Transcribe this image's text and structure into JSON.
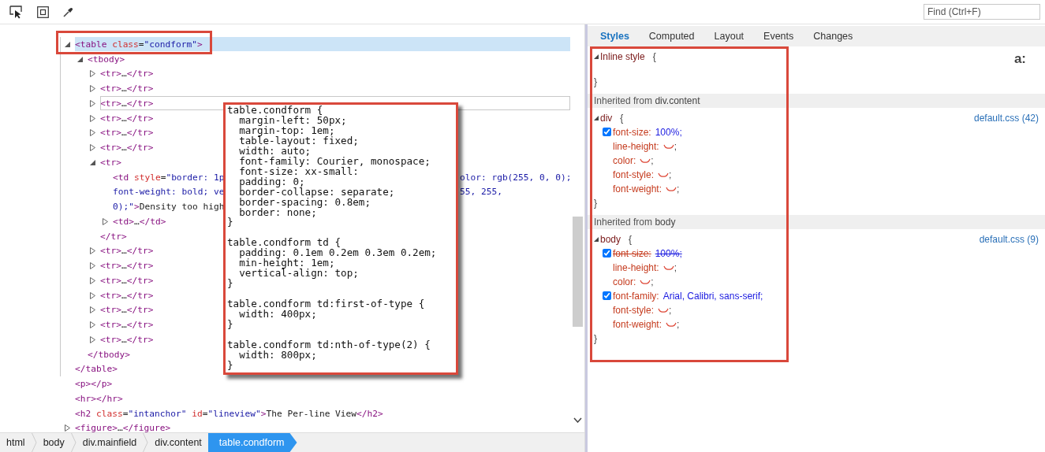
{
  "toolbar": {
    "find": {
      "placeholder": "Find (Ctrl+F)"
    }
  },
  "dom_tree": {
    "nodes": [
      {
        "expanded": true,
        "selected": true,
        "hovered": false,
        "tokens": [
          {
            "kind": "tag",
            "text": "<table"
          },
          {
            "kind": "attr",
            "text": " class"
          },
          {
            "kind": "punct",
            "text": "="
          },
          {
            "kind": "value",
            "text": "\"condform\""
          },
          {
            "kind": "tag",
            "text": ">"
          }
        ],
        "close_tokens": [
          {
            "kind": "tag",
            "text": "</table>"
          }
        ],
        "children": [
          {
            "expanded": true,
            "selected": false,
            "hovered": false,
            "tokens": [
              {
                "kind": "tag",
                "text": "<tbody>"
              }
            ],
            "close_tokens": [
              {
                "kind": "tag",
                "text": "</tbody>"
              }
            ],
            "children": [
              {
                "expanded": false,
                "selected": false,
                "hovered": false,
                "tokens": [
                  {
                    "kind": "tag",
                    "text": "<tr>"
                  },
                  {
                    "kind": "text",
                    "text": "…"
                  },
                  {
                    "kind": "tag",
                    "text": "</tr>"
                  }
                ]
              },
              {
                "expanded": false,
                "selected": false,
                "hovered": false,
                "tokens": [
                  {
                    "kind": "tag",
                    "text": "<tr>"
                  },
                  {
                    "kind": "text",
                    "text": "…"
                  },
                  {
                    "kind": "tag",
                    "text": "</tr>"
                  }
                ]
              },
              {
                "expanded": false,
                "selected": false,
                "hovered": true,
                "tokens": [
                  {
                    "kind": "tag",
                    "text": "<tr>"
                  },
                  {
                    "kind": "text",
                    "text": "…"
                  },
                  {
                    "kind": "tag",
                    "text": "</tr>"
                  }
                ]
              },
              {
                "expanded": false,
                "selected": false,
                "hovered": false,
                "tokens": [
                  {
                    "kind": "tag",
                    "text": "<tr>"
                  },
                  {
                    "kind": "text",
                    "text": "…"
                  },
                  {
                    "kind": "tag",
                    "text": "</tr>"
                  }
                ]
              },
              {
                "expanded": false,
                "selected": false,
                "hovered": false,
                "tokens": [
                  {
                    "kind": "tag",
                    "text": "<tr>"
                  },
                  {
                    "kind": "text",
                    "text": "…"
                  },
                  {
                    "kind": "tag",
                    "text": "</tr>"
                  }
                ]
              },
              {
                "expanded": false,
                "selected": false,
                "hovered": false,
                "tokens": [
                  {
                    "kind": "tag",
                    "text": "<tr>"
                  },
                  {
                    "kind": "text",
                    "text": "…"
                  },
                  {
                    "kind": "tag",
                    "text": "</tr>"
                  }
                ]
              },
              {
                "expanded": true,
                "selected": false,
                "hovered": false,
                "tokens": [
                  {
                    "kind": "tag",
                    "text": "<tr>"
                  }
                ],
                "close_tokens": [
                  {
                    "kind": "tag",
                    "text": "</tr>"
                  }
                ],
                "children": [
                  {
                    "lines": [
                      {
                        "left": [
                          {
                            "kind": "tag",
                            "text": "<td"
                          },
                          {
                            "kind": "attr",
                            "text": " style"
                          },
                          {
                            "kind": "punct",
                            "text": "="
                          },
                          {
                            "kind": "value",
                            "text": "\"border: 1p"
                          }
                        ],
                        "right": [
                          {
                            "kind": "value",
                            "text": "olor: rgb(255, 0, 0);"
                          }
                        ]
                      },
                      {
                        "left": [
                          {
                            "kind": "value",
                            "text": "font-weight: bold; ve"
                          }
                        ],
                        "right": [
                          {
                            "kind": "value",
                            "text": "55, 255,"
                          }
                        ]
                      },
                      {
                        "left": [
                          {
                            "kind": "value",
                            "text": "0);\""
                          },
                          {
                            "kind": "tag",
                            "text": ">"
                          },
                          {
                            "kind": "text",
                            "text": "Density too high"
                          }
                        ]
                      }
                    ]
                  },
                  {
                    "expanded": false,
                    "selected": false,
                    "hovered": false,
                    "tokens": [
                      {
                        "kind": "tag",
                        "text": "<td>"
                      },
                      {
                        "kind": "text",
                        "text": "…"
                      },
                      {
                        "kind": "tag",
                        "text": "</td>"
                      }
                    ]
                  }
                ]
              },
              {
                "expanded": false,
                "selected": false,
                "hovered": false,
                "tokens": [
                  {
                    "kind": "tag",
                    "text": "<tr>"
                  },
                  {
                    "kind": "text",
                    "text": "…"
                  },
                  {
                    "kind": "tag",
                    "text": "</tr>"
                  }
                ]
              },
              {
                "expanded": false,
                "selected": false,
                "hovered": false,
                "tokens": [
                  {
                    "kind": "tag",
                    "text": "<tr>"
                  },
                  {
                    "kind": "text",
                    "text": "…"
                  },
                  {
                    "kind": "tag",
                    "text": "</tr>"
                  }
                ]
              },
              {
                "expanded": false,
                "selected": false,
                "hovered": false,
                "tokens": [
                  {
                    "kind": "tag",
                    "text": "<tr>"
                  },
                  {
                    "kind": "text",
                    "text": "…"
                  },
                  {
                    "kind": "tag",
                    "text": "</tr>"
                  }
                ]
              },
              {
                "expanded": false,
                "selected": false,
                "hovered": false,
                "tokens": [
                  {
                    "kind": "tag",
                    "text": "<tr>"
                  },
                  {
                    "kind": "text",
                    "text": "…"
                  },
                  {
                    "kind": "tag",
                    "text": "</tr>"
                  }
                ]
              },
              {
                "expanded": false,
                "selected": false,
                "hovered": false,
                "tokens": [
                  {
                    "kind": "tag",
                    "text": "<tr>"
                  },
                  {
                    "kind": "text",
                    "text": "…"
                  },
                  {
                    "kind": "tag",
                    "text": "</tr>"
                  }
                ]
              },
              {
                "expanded": false,
                "selected": false,
                "hovered": false,
                "tokens": [
                  {
                    "kind": "tag",
                    "text": "<tr>"
                  },
                  {
                    "kind": "text",
                    "text": "…"
                  },
                  {
                    "kind": "tag",
                    "text": "</tr>"
                  }
                ]
              },
              {
                "expanded": false,
                "selected": false,
                "hovered": false,
                "tokens": [
                  {
                    "kind": "tag",
                    "text": "<tr>"
                  },
                  {
                    "kind": "text",
                    "text": "…"
                  },
                  {
                    "kind": "tag",
                    "text": "</tr>"
                  }
                ]
              }
            ]
          }
        ]
      },
      {
        "selected": false,
        "hovered": false,
        "tokens": [
          {
            "kind": "tag",
            "text": "<p></p>"
          }
        ]
      },
      {
        "selected": false,
        "hovered": false,
        "tokens": [
          {
            "kind": "tag",
            "text": "<hr></hr>"
          }
        ]
      },
      {
        "selected": false,
        "hovered": false,
        "tokens": [
          {
            "kind": "tag",
            "text": "<h2"
          },
          {
            "kind": "attr",
            "text": " class"
          },
          {
            "kind": "punct",
            "text": "="
          },
          {
            "kind": "value",
            "text": "\"intanchor\""
          },
          {
            "kind": "attr",
            "text": " id"
          },
          {
            "kind": "punct",
            "text": "="
          },
          {
            "kind": "value",
            "text": "\"lineview\""
          },
          {
            "kind": "tag",
            "text": ">"
          },
          {
            "kind": "text",
            "text": "The Per-line View"
          },
          {
            "kind": "tag",
            "text": "</h2>"
          }
        ]
      },
      {
        "expanded": false,
        "selected": false,
        "hovered": false,
        "tokens": [
          {
            "kind": "tag",
            "text": "<figure>"
          },
          {
            "kind": "text",
            "text": "…"
          },
          {
            "kind": "tag",
            "text": "</figure>"
          }
        ]
      }
    ]
  },
  "callout": {
    "code": "table.condform {\n  margin-left: 50px;\n  margin-top: 1em;\n  table-layout: fixed;\n  width: auto;\n  font-family: Courier, monospace;\n  font-size: xx-small:\n  padding: 0;\n  border-collapse: separate;\n  border-spacing: 0.8em;\n  border: none;\n}\n\ntable.condform td {\n  padding: 0.1em 0.2em 0.3em 0.2em;\n  min-height: 1em;\n  vertical-align: top;\n}\n\ntable.condform td:first-of-type {\n  width: 400px;\n}\n\ntable.condform td:nth-of-type(2) {\n  width: 800px;\n}"
  },
  "breadcrumbs": [
    {
      "label": "html",
      "selected": false
    },
    {
      "label": "body",
      "selected": false
    },
    {
      "label": "div.mainfield",
      "selected": false
    },
    {
      "label": "div.content",
      "selected": false
    },
    {
      "label": "table.condform",
      "selected": true
    }
  ],
  "styles_panel": {
    "tabs": [
      {
        "label": "Styles",
        "selected": true
      },
      {
        "label": "Computed",
        "selected": false
      },
      {
        "label": "Layout",
        "selected": false
      },
      {
        "label": "Events",
        "selected": false
      },
      {
        "label": "Changes",
        "selected": false
      }
    ],
    "state_toggle": "a:",
    "sections": [
      {
        "kind": "rule",
        "selector": "Inline style",
        "open": "{",
        "close": "}"
      },
      {
        "kind": "header",
        "prefix": "Inherited from",
        "link": "div.content"
      },
      {
        "kind": "rule",
        "selector": "div",
        "open": "{",
        "source": "default.css (42)",
        "close": "}",
        "declarations": [
          {
            "kind": "set",
            "property": "font-size:",
            "value": "100%;",
            "checked": true,
            "overridden": false
          },
          {
            "kind": "unset",
            "property": "line-height:",
            "value": ";"
          },
          {
            "kind": "unset",
            "property": "color:",
            "value": ";"
          },
          {
            "kind": "unset",
            "property": "font-style:",
            "value": ";"
          },
          {
            "kind": "unset",
            "property": "font-weight:",
            "value": ";"
          }
        ]
      },
      {
        "kind": "header",
        "prefix": "Inherited from",
        "link": "body"
      },
      {
        "kind": "rule",
        "selector": "body",
        "open": "{",
        "source": "default.css (9)",
        "close": "}",
        "declarations": [
          {
            "kind": "set",
            "property": "font-size:",
            "value": "100%;",
            "checked": true,
            "overridden": true
          },
          {
            "kind": "unset",
            "property": "line-height:",
            "value": ";"
          },
          {
            "kind": "unset",
            "property": "color:",
            "value": ";"
          },
          {
            "kind": "set",
            "property": "font-family:",
            "value": "Arial, Calibri, sans-serif;",
            "checked": true,
            "overridden": false
          },
          {
            "kind": "unset",
            "property": "font-style:",
            "value": ";"
          },
          {
            "kind": "unset",
            "property": "font-weight:",
            "value": ";"
          }
        ]
      }
    ]
  }
}
